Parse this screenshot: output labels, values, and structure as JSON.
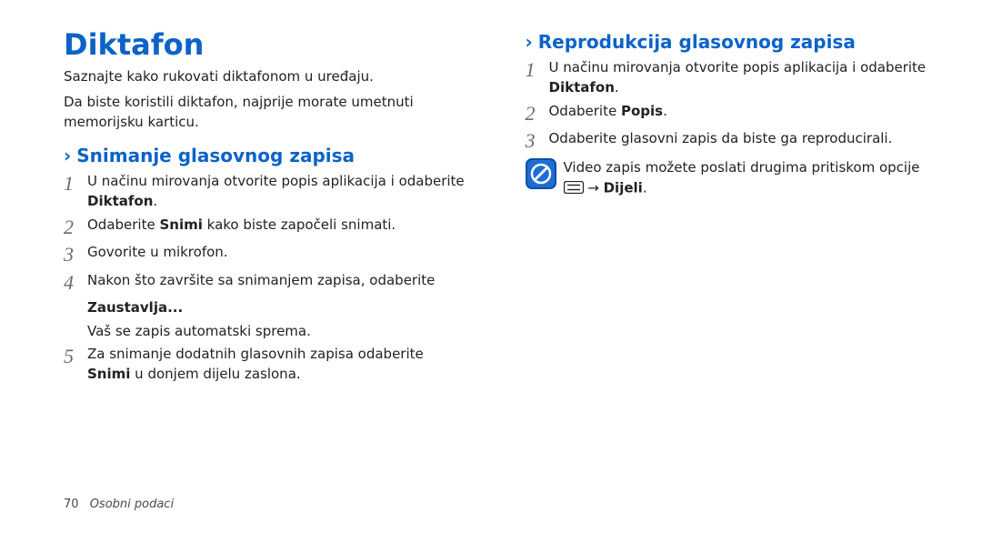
{
  "left": {
    "title": "Diktafon",
    "intro1": "Saznajte kako rukovati diktafonom u uređaju.",
    "intro2": "Da biste koristili diktafon, najprije morate umetnuti memorijsku karticu.",
    "sub_chev": "›",
    "sub": "Snimanje glasovnog zapisa",
    "step1_num": "1",
    "step1_txt": "U načinu mirovanja otvorite popis aplikacija i odaberite ",
    "step1_bold": "Diktafon",
    "step1_dot": ".",
    "step2_num": "2",
    "step2_pre": "Odaberite ",
    "step2_bold": "Snimi",
    "step2_post": " kako biste započeli snimati.",
    "step3_num": "3",
    "step3_txt": "Govorite u mikrofon.",
    "step4_num": "4",
    "step4_txt": "Nakon što završite sa snimanjem zapisa, odaberite ",
    "step4_bold": "Zaustavlja...",
    "step4_aux": "Vaš se zapis automatski sprema.",
    "step5_num": "5",
    "step5_pre": "Za snimanje dodatnih glasovnih zapisa odaberite ",
    "step5_bold": "Snimi",
    "step5_post": " u donjem dijelu zaslona."
  },
  "right": {
    "sub_chev": "›",
    "sub": "Reprodukcija glasovnog zapisa",
    "step1_num": "1",
    "step1_txt": "U načinu mirovanja otvorite popis aplikacija i odaberite ",
    "step1_bold": "Diktafon",
    "step1_dot": ".",
    "step2_num": "2",
    "step2_pre": "Odaberite ",
    "step2_bold": "Popis",
    "step2_post": ".",
    "step3_num": "3",
    "step3_txt": "Odaberite glasovni zapis da biste ga reproducirali.",
    "note_line1": "Video zapis možete poslati drugima pritiskom opcije",
    "note_arrow": " → ",
    "note_bold": "Dijeli",
    "note_dot": "."
  },
  "footer": {
    "pagenum": "70",
    "section": "Osobni podaci"
  }
}
